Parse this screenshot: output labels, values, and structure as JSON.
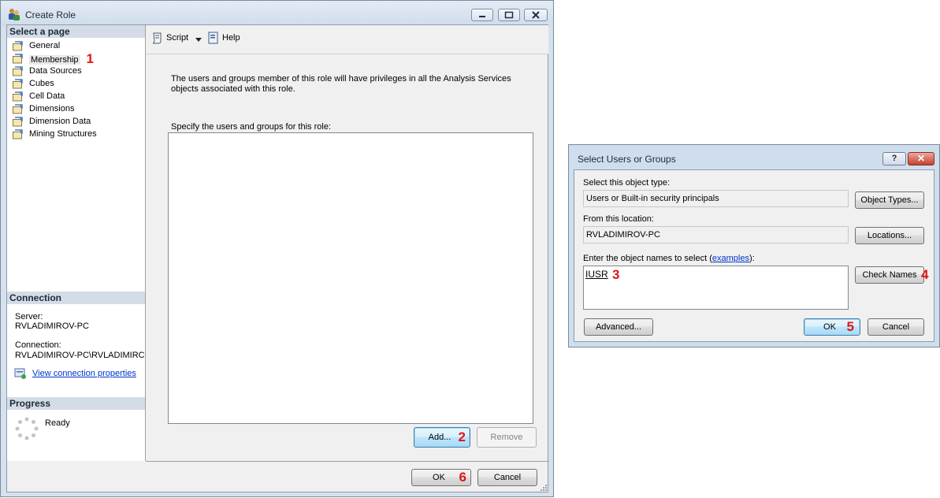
{
  "main_window": {
    "title": "Create Role",
    "select_page_header": "Select a page",
    "pages": [
      "General",
      "Membership",
      "Data Sources",
      "Cubes",
      "Cell Data",
      "Dimensions",
      "Dimension Data",
      "Mining Structures"
    ],
    "toolbar": {
      "script_label": "Script",
      "help_label": "Help"
    },
    "description": "The users and groups member of this role will have privileges in all the Analysis Services objects associated with this role.",
    "specify_label": "Specify the users and groups for this role:",
    "add_label": "Add...",
    "remove_label": "Remove",
    "ok_label": "OK",
    "cancel_label": "Cancel",
    "connection": {
      "header": "Connection",
      "server_label": "Server:",
      "server_value": "RVLADIMIROV-PC",
      "connection_label": "Connection:",
      "connection_value": "RVLADIMIROV-PC\\RVLADIMIRC",
      "view_props_link": "View connection properties"
    },
    "progress": {
      "header": "Progress",
      "status": "Ready"
    }
  },
  "dialog": {
    "title": "Select Users or Groups",
    "help_glyph": "?",
    "close_glyph": "✕",
    "object_type_label": "Select this object type:",
    "object_type_value": "Users or Built-in security principals",
    "object_types_button": "Object Types...",
    "location_label": "From this location:",
    "location_value": "RVLADIMIROV-PC",
    "locations_button": "Locations...",
    "enter_names_label_prefix": "Enter the object names to select (",
    "examples_link": "examples",
    "enter_names_label_suffix": "):",
    "names_value": "IUSR",
    "check_names_button": "Check Names",
    "advanced_button": "Advanced...",
    "ok_label": "OK",
    "cancel_label": "Cancel"
  },
  "step_markers": {
    "membership": "1",
    "add": "2",
    "iusr": "3",
    "check_names": "4",
    "dialog_ok": "5",
    "main_ok": "6"
  },
  "colors": {
    "step_marker": "#e01515",
    "link": "#0033cc",
    "section_header_bg": "#d4dce8"
  }
}
